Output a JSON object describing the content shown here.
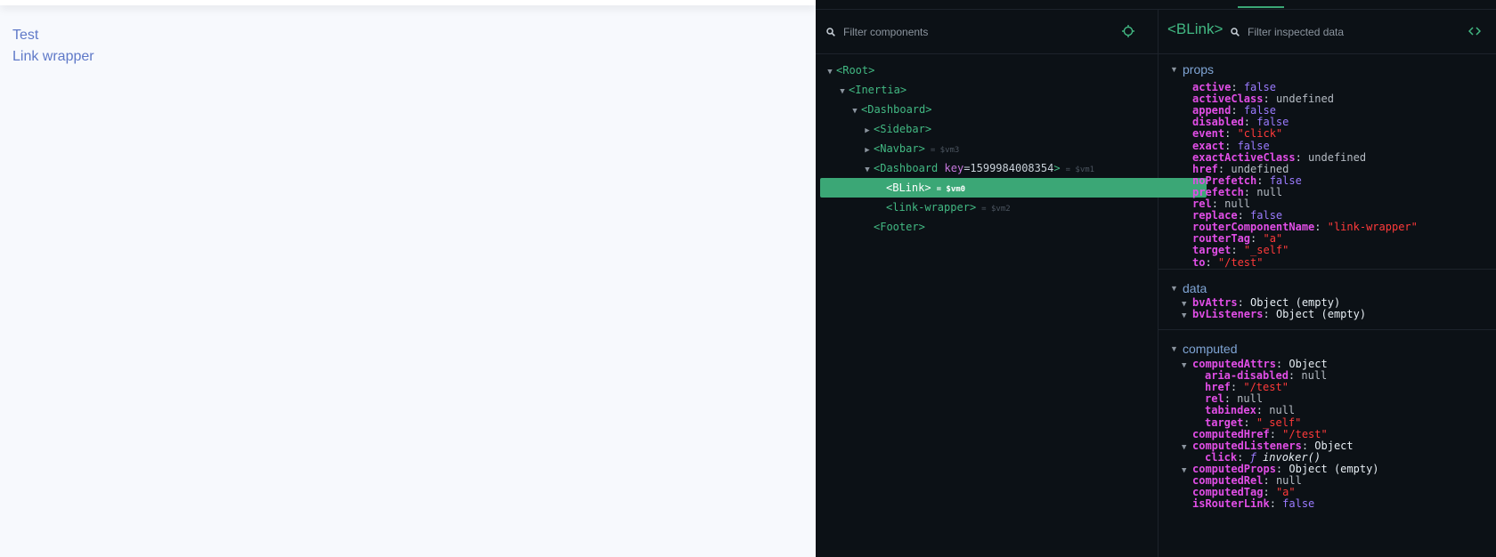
{
  "app": {
    "links": [
      "Test",
      "Link wrapper"
    ]
  },
  "devtools": {
    "tree": {
      "filter_placeholder": "Filter components",
      "nodes": [
        {
          "indent": 0,
          "expander": "▼",
          "name": "Root",
          "attr_key": "",
          "attr_val": "",
          "vm": "",
          "selected": false
        },
        {
          "indent": 1,
          "expander": "▼",
          "name": "Inertia",
          "attr_key": "",
          "attr_val": "",
          "vm": "",
          "selected": false
        },
        {
          "indent": 2,
          "expander": "▼",
          "name": "Dashboard",
          "attr_key": "",
          "attr_val": "",
          "vm": "",
          "selected": false
        },
        {
          "indent": 3,
          "expander": "▶",
          "name": "Sidebar",
          "attr_key": "",
          "attr_val": "",
          "vm": "",
          "selected": false
        },
        {
          "indent": 3,
          "expander": "▶",
          "name": "Navbar",
          "attr_key": "",
          "attr_val": "",
          "vm": "= $vm3",
          "selected": false
        },
        {
          "indent": 3,
          "expander": "▼",
          "name": "Dashboard",
          "attr_key": "key",
          "attr_val": "=1599984008354",
          "vm": "= $vm1",
          "selected": false
        },
        {
          "indent": 4,
          "expander": "",
          "name": "BLink",
          "attr_key": "",
          "attr_val": "",
          "vm": "= $vm0",
          "selected": true
        },
        {
          "indent": 4,
          "expander": "",
          "name": "link-wrapper",
          "attr_key": "",
          "attr_val": "",
          "vm": "= $vm2",
          "selected": false
        },
        {
          "indent": 3,
          "expander": "",
          "name": "Footer",
          "attr_key": "",
          "attr_val": "",
          "vm": "",
          "selected": false
        }
      ]
    },
    "inspector": {
      "component_name": "<BLink>",
      "filter_placeholder": "Filter inspected data",
      "sections": [
        {
          "title": "props",
          "items": [
            {
              "key": "active",
              "value": "false",
              "type": "bool",
              "expander": "",
              "level": 0
            },
            {
              "key": "activeClass",
              "value": "undefined",
              "type": "null",
              "expander": "",
              "level": 0
            },
            {
              "key": "append",
              "value": "false",
              "type": "bool",
              "expander": "",
              "level": 0
            },
            {
              "key": "disabled",
              "value": "false",
              "type": "bool",
              "expander": "",
              "level": 0
            },
            {
              "key": "event",
              "value": "\"click\"",
              "type": "str",
              "expander": "",
              "level": 0
            },
            {
              "key": "exact",
              "value": "false",
              "type": "bool",
              "expander": "",
              "level": 0
            },
            {
              "key": "exactActiveClass",
              "value": "undefined",
              "type": "null",
              "expander": "",
              "level": 0
            },
            {
              "key": "href",
              "value": "undefined",
              "type": "null",
              "expander": "",
              "level": 0
            },
            {
              "key": "noPrefetch",
              "value": "false",
              "type": "bool",
              "expander": "",
              "level": 0
            },
            {
              "key": "prefetch",
              "value": "null",
              "type": "null",
              "expander": "",
              "level": 0
            },
            {
              "key": "rel",
              "value": "null",
              "type": "null",
              "expander": "",
              "level": 0
            },
            {
              "key": "replace",
              "value": "false",
              "type": "bool",
              "expander": "",
              "level": 0
            },
            {
              "key": "routerComponentName",
              "value": "\"link-wrapper\"",
              "type": "str",
              "expander": "",
              "level": 0
            },
            {
              "key": "routerTag",
              "value": "\"a\"",
              "type": "str",
              "expander": "",
              "level": 0
            },
            {
              "key": "target",
              "value": "\"_self\"",
              "type": "str",
              "expander": "",
              "level": 0
            },
            {
              "key": "to",
              "value": "\"/test\"",
              "type": "str",
              "expander": "",
              "level": 0
            }
          ]
        },
        {
          "title": "data",
          "items": [
            {
              "key": "bvAttrs",
              "value": "Object (empty)",
              "type": "obj",
              "expander": "▼",
              "level": 0
            },
            {
              "key": "bvListeners",
              "value": "Object (empty)",
              "type": "obj",
              "expander": "▼",
              "level": 0
            }
          ]
        },
        {
          "title": "computed",
          "items": [
            {
              "key": "computedAttrs",
              "value": "Object",
              "type": "obj",
              "expander": "▼",
              "level": 0
            },
            {
              "key": "aria-disabled",
              "value": "null",
              "type": "null",
              "expander": "",
              "level": 1
            },
            {
              "key": "href",
              "value": "\"/test\"",
              "type": "str",
              "expander": "",
              "level": 1
            },
            {
              "key": "rel",
              "value": "null",
              "type": "null",
              "expander": "",
              "level": 1
            },
            {
              "key": "tabindex",
              "value": "null",
              "type": "null",
              "expander": "",
              "level": 1
            },
            {
              "key": "target",
              "value": "\"_self\"",
              "type": "str",
              "expander": "",
              "level": 1
            },
            {
              "key": "computedHref",
              "value": "\"/test\"",
              "type": "str",
              "expander": "",
              "level": 0
            },
            {
              "key": "computedListeners",
              "value": "Object",
              "type": "obj",
              "expander": "▼",
              "level": 0
            },
            {
              "key": "click",
              "value": "invoker()",
              "type": "fn",
              "expander": "",
              "level": 1
            },
            {
              "key": "computedProps",
              "value": "Object (empty)",
              "type": "obj",
              "expander": "▼",
              "level": 0
            },
            {
              "key": "computedRel",
              "value": "null",
              "type": "null",
              "expander": "",
              "level": 0
            },
            {
              "key": "computedTag",
              "value": "\"a\"",
              "type": "str",
              "expander": "",
              "level": 0
            },
            {
              "key": "isRouterLink",
              "value": "false",
              "type": "bool",
              "expander": "",
              "level": 0
            }
          ]
        }
      ]
    },
    "colors": {
      "accent": "#42b983",
      "selected_row": "#3ba776",
      "background": "#0c1116",
      "link": "#5f79c8"
    }
  }
}
